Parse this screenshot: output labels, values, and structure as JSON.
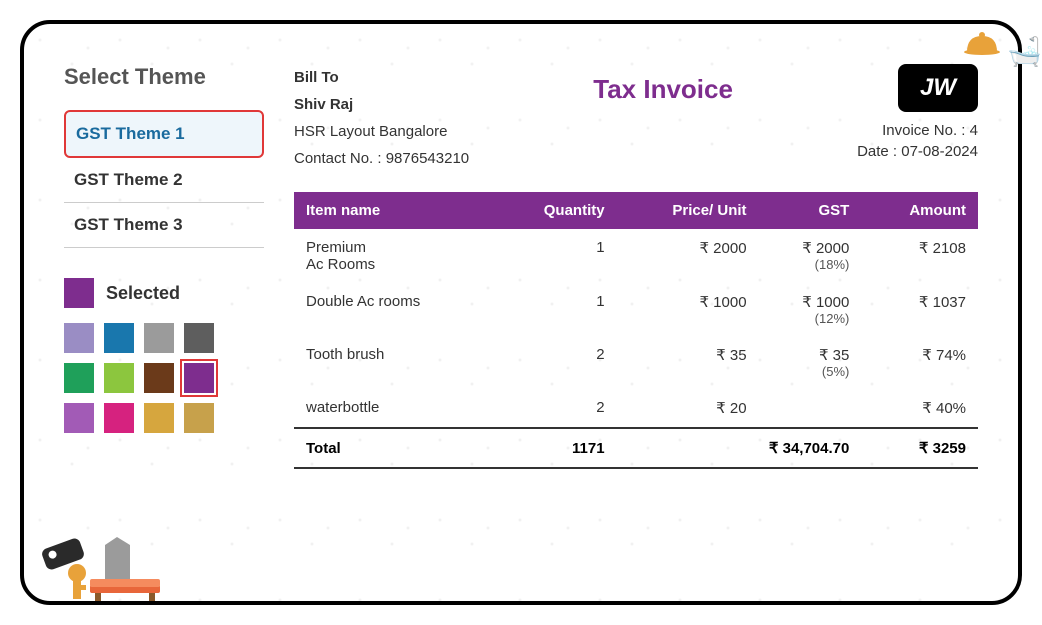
{
  "sidebar": {
    "title": "Select Theme",
    "themes": [
      {
        "label": "GST Theme 1"
      },
      {
        "label": "GST Theme 2"
      },
      {
        "label": "GST Theme 3"
      }
    ],
    "selected_label": "Selected",
    "selected_color": "#7e2d8e",
    "swatches": [
      "#9a8dc4",
      "#1977ad",
      "#9b9b9b",
      "#5e5e5e",
      "#1fa05a",
      "#8cc63e",
      "#6b3a1a",
      "#7e2d8e",
      "#a25bb6",
      "#d6227f",
      "#d6a63e",
      "#c7a14b"
    ],
    "active_swatch_index": 7
  },
  "invoice": {
    "bill_to_label": "Bill To",
    "bill_to_name": "Shiv Raj",
    "bill_to_address": "HSR Layout Bangalore",
    "contact_label": "Contact No. : ",
    "contact_no": "9876543210",
    "title": "Tax Invoice",
    "logo_text": "JW",
    "invoice_no_label": "Invoice No. : ",
    "invoice_no": "4",
    "date_label": "Date : ",
    "date": "07-08-2024",
    "headers": {
      "item_name": "Item name",
      "quantity": "Quantity",
      "price_unit": "Price/ Unit",
      "gst": "GST",
      "amount": "Amount"
    },
    "items": [
      {
        "name": "Premium Ac Rooms",
        "quantity": "1",
        "price": "₹ 2000",
        "gst": "₹ 2000",
        "gst_pct": "(18%)",
        "amount": "₹ 2108"
      },
      {
        "name": "Double Ac rooms",
        "quantity": "1",
        "price": "₹ 1000",
        "gst": "₹ 1000",
        "gst_pct": "(12%)",
        "amount": "₹ 1037"
      },
      {
        "name": "Tooth brush",
        "quantity": "2",
        "price": "₹ 35",
        "gst": "₹ 35",
        "gst_pct": "(5%)",
        "amount": "₹ 74%"
      },
      {
        "name": "waterbottle",
        "quantity": "2",
        "price": "₹ 20",
        "gst": "",
        "gst_pct": "",
        "amount": "₹ 40%"
      }
    ],
    "total": {
      "label": "Total",
      "quantity": "1171",
      "gst": "₹ 34,704.70",
      "amount": "₹ 3259"
    }
  }
}
